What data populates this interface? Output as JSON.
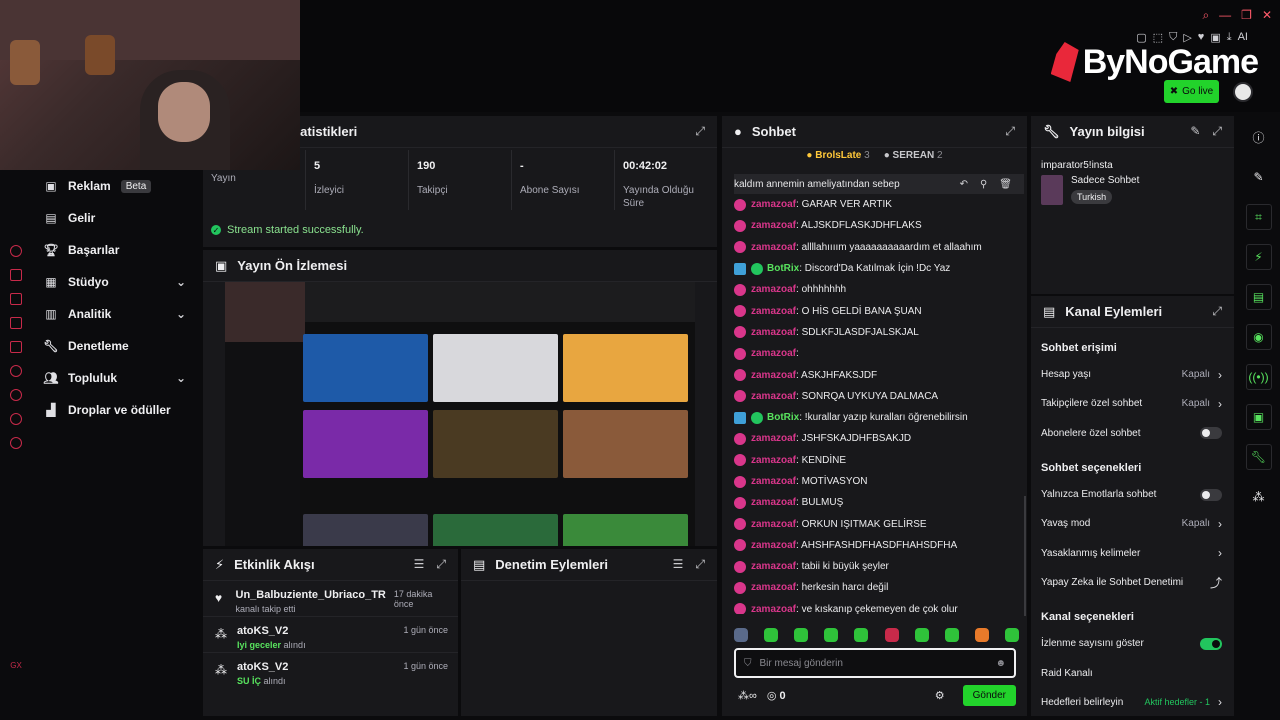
{
  "app": {
    "logo_text": "ByNoGame",
    "go_live_label": "Go live",
    "toolbar_ai_label": "AI"
  },
  "sidebar": {
    "items": [
      {
        "label": "Reklam",
        "badge": "Beta",
        "icon": "ad-icon",
        "expandable": false
      },
      {
        "label": "Gelir",
        "icon": "revenue-icon",
        "expandable": false
      },
      {
        "label": "Başarılar",
        "icon": "trophy-icon",
        "expandable": false
      },
      {
        "label": "Stüdyo",
        "icon": "studio-icon",
        "expandable": true
      },
      {
        "label": "Analitik",
        "icon": "analytics-icon",
        "expandable": true
      },
      {
        "label": "Denetleme",
        "icon": "wrench-icon",
        "expandable": false
      },
      {
        "label": "Topluluk",
        "icon": "community-icon",
        "expandable": true
      },
      {
        "label": "Droplar ve ödüller",
        "icon": "drops-icon",
        "expandable": false
      }
    ],
    "rail_footer": "GX"
  },
  "stats": {
    "title": "İstatistikleri",
    "title_visible": "istatistikleri",
    "items": [
      {
        "value": "",
        "label": "Yayın"
      },
      {
        "value": "5",
        "label": "İzleyici"
      },
      {
        "value": "190",
        "label": "Takipçi"
      },
      {
        "value": "-",
        "label": "Abone Sayısı"
      },
      {
        "value": "00:42:02",
        "label": "Yayında Olduğu Süre"
      }
    ],
    "status": "Stream started successfully."
  },
  "preview": {
    "title": "Yayın Ön İzlemesi"
  },
  "activity": {
    "title": "Etkinlik Akışı",
    "items": [
      {
        "name": "Un_Balbuziente_Ubriaco_TR",
        "sub": "kanalı takip etti",
        "highlight": "",
        "time": "17 dakika önce",
        "icon": "heart-icon"
      },
      {
        "name": "atoKS_V2",
        "sub": "alındı",
        "highlight": "Iyi geceler",
        "time": "1 gün önce",
        "icon": "points-icon"
      },
      {
        "name": "atoKS_V2",
        "sub": "alındı",
        "highlight": "SU İÇ",
        "time": "1 gün önce",
        "icon": "points-icon"
      }
    ]
  },
  "moderation": {
    "title": "Denetim Eylemleri"
  },
  "chat": {
    "title": "Sohbet",
    "pinned": [
      {
        "name": "BrolsLate",
        "count": "3",
        "tier": "gold"
      },
      {
        "name": "SEREAN",
        "count": "2",
        "tier": "silver"
      }
    ],
    "highlighted_message": "kaldım annemin ameliyatından sebep",
    "messages": [
      {
        "user": "zamazoaf",
        "text": ": GARAR VER ARTIK",
        "bot": false
      },
      {
        "user": "zamazoaf",
        "text": ": ALJSKDFLASKJDHFLAKS",
        "bot": false
      },
      {
        "user": "zamazoaf",
        "text": ": allllahıııım yaaaaaaaaaardım et allaahım",
        "bot": false
      },
      {
        "user": "BotRix",
        "text": ": Discord'Da Katılmak İçin !Dc Yaz",
        "bot": true
      },
      {
        "user": "zamazoaf",
        "text": ": ohhhhhhh",
        "bot": false
      },
      {
        "user": "zamazoaf",
        "text": ": O HİS GELDİ BANA ŞUAN",
        "bot": false
      },
      {
        "user": "zamazoaf",
        "text": ": SDLKFJLASDFJALSKJAL",
        "bot": false
      },
      {
        "user": "zamazoaf",
        "text": ":",
        "bot": false
      },
      {
        "user": "zamazoaf",
        "text": ": ASKJHFAKSJDF",
        "bot": false
      },
      {
        "user": "zamazoaf",
        "text": ": SONRQA UYKUYA DALMACA",
        "bot": false
      },
      {
        "user": "BotRix",
        "text": ": !kurallar yazıp kuralları öğrenebilirsin",
        "bot": true
      },
      {
        "user": "zamazoaf",
        "text": ": JSHFSKAJDHFBSAKJD",
        "bot": false
      },
      {
        "user": "zamazoaf",
        "text": ": KENDİNE",
        "bot": false
      },
      {
        "user": "zamazoaf",
        "text": ": MOTİVASYON",
        "bot": false
      },
      {
        "user": "zamazoaf",
        "text": ": BULMUŞ",
        "bot": false
      },
      {
        "user": "zamazoaf",
        "text": ": ORKUN IŞITMAK GELİRSE",
        "bot": false
      },
      {
        "user": "zamazoaf",
        "text": ": AHSHFASHDFHASDFHAHSDFHA",
        "bot": false
      },
      {
        "user": "zamazoaf",
        "text": ": tabii ki büyük şeyler",
        "bot": false
      },
      {
        "user": "zamazoaf",
        "text": ": herkesin harcı değil",
        "bot": false
      },
      {
        "user": "zamazoaf",
        "text": ": ve kıskanıp çekemeyen de çok olur",
        "bot": false
      }
    ],
    "input_placeholder": "Bir mesaj gönderin",
    "points": "0",
    "send_label": "Gönder"
  },
  "stream_info": {
    "title": "Yayın bilgisi",
    "stream_title": "imparator5!insta",
    "category": "Sadece Sohbet",
    "tag": "Turkish"
  },
  "channel_actions": {
    "title": "Kanal Eylemleri",
    "sections": [
      {
        "heading": "Sohbet erişimi",
        "options": [
          {
            "label": "Hesap yaşı",
            "value": "Kapalı",
            "control": "arrow"
          },
          {
            "label": "Takipçilere özel sohbet",
            "value": "Kapalı",
            "control": "arrow"
          },
          {
            "label": "Abonelere özel sohbet",
            "value": "",
            "control": "toggle-off"
          }
        ]
      },
      {
        "heading": "Sohbet seçenekleri",
        "options": [
          {
            "label": "Yalnızca Emotlarla sohbet",
            "value": "",
            "control": "toggle-off"
          },
          {
            "label": "Yavaş mod",
            "value": "Kapalı",
            "control": "arrow"
          },
          {
            "label": "Yasaklanmış kelimeler",
            "value": "",
            "control": "arrow"
          },
          {
            "label": "Yapay Zeka ile Sohbet Denetimi",
            "value": "",
            "control": "external"
          }
        ]
      },
      {
        "heading": "Kanal seçenekleri",
        "options": [
          {
            "label": "İzlenme sayısını göster",
            "value": "",
            "control": "toggle-on"
          },
          {
            "label": "Raid Kanalı",
            "value": "",
            "control": "none"
          },
          {
            "label": "Hedefleri belirleyin",
            "value": "Aktif hedefler - 1",
            "control": "arrow"
          }
        ]
      }
    ]
  }
}
